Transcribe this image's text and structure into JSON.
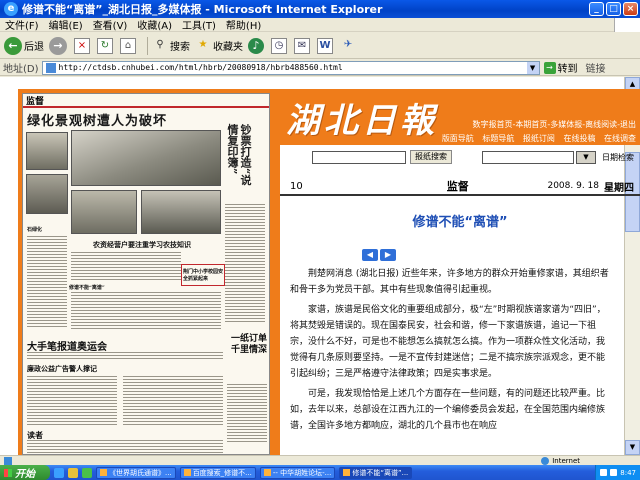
{
  "window": {
    "title": "修谱不能“离谱”_湖北日报_多媒体报 - Microsoft Internet Explorer",
    "app_icon": "ie-icon"
  },
  "menu": [
    "文件(F)",
    "编辑(E)",
    "查看(V)",
    "收藏(A)",
    "工具(T)",
    "帮助(H)"
  ],
  "toolbar": {
    "back": "后退",
    "search": "搜索",
    "favorites": "收藏夹"
  },
  "address": {
    "label": "地址(D)",
    "url": "http://ctdsb.cnhubei.com/html/hbrb/20080918/hbrb488560.html",
    "go": "转到",
    "links": "链接"
  },
  "newspaper": {
    "section": "监督",
    "headline": "绿化景观树遭人为破坏",
    "side_big": "钞票打造“说情复印簿”",
    "sub1": "石绿化",
    "sub2": "农资经营户要注重学习农技知识",
    "sub3": "修谱不能“离谱”",
    "sub4": "大手笔报道奥运会",
    "sub5": "廉政公益广告警人撑记",
    "sub6": "一纸订单千里情深",
    "sub7": "读者",
    "sub8": "荆门中小学校园安全抓紧起来"
  },
  "masthead": {
    "logo": "湖北日報",
    "nav1": "数字报首页-本期首页-多媒体报-离线阅读-退出",
    "nav2": [
      "版面导航",
      "标题导航",
      "报纸订阅",
      "在线投稿",
      "在线调查"
    ]
  },
  "search": {
    "button": "报纸搜索",
    "date_label": "日期检索"
  },
  "info": {
    "page_number": "10",
    "section": "监督",
    "date": "2008. 9. 18",
    "weekday": "星期四"
  },
  "article": {
    "title": "修谱不能“离谱”",
    "paragraphs": [
      "荆楚网消息 (湖北日报) 近些年来，许多地方的群众开始重修家谱，其组织者和骨干多为党员干部。其中有些现象值得引起重视。",
      "家谱，族谱是民俗文化的重要组成部分，极“左”时期视族谱家谱为“四旧”，将其焚毁是错误的。现在国泰民安，社会和谐，修一下家谱族谱，追记一下祖宗，没什么不好，可是也不能想怎么搞就怎么搞。作为一项群众性文化活动，我觉得有几条原则要坚持。一是不宣传封建迷信；二是不搞宗族宗派观念，更不能引起纠纷；三是严格遵守法律政策；四是实事求是。",
      "可是，我发现恰恰是上述几个方面存在一些问题，有的问题还比较严重。比如，去年以来，总部设在江西九江的一个编修委员会发起，在全国范围内编修族谱，全国许多地方都响应，湖北的几个县市也在响应"
    ]
  },
  "status": {
    "zone": "Internet"
  },
  "taskbar": {
    "start": "开始",
    "tasks": [
      "《世界胡氏通谱》...",
      "百度搜索_修谱不...",
      "-- 中华胡姓论坛-...",
      "修谱不能“离谱”..."
    ],
    "clock": "8:47"
  },
  "colors": {
    "brand_orange": "#ef7c1a",
    "title_blue": "#1f4fb5",
    "xp_blue": "#0a58e8"
  }
}
